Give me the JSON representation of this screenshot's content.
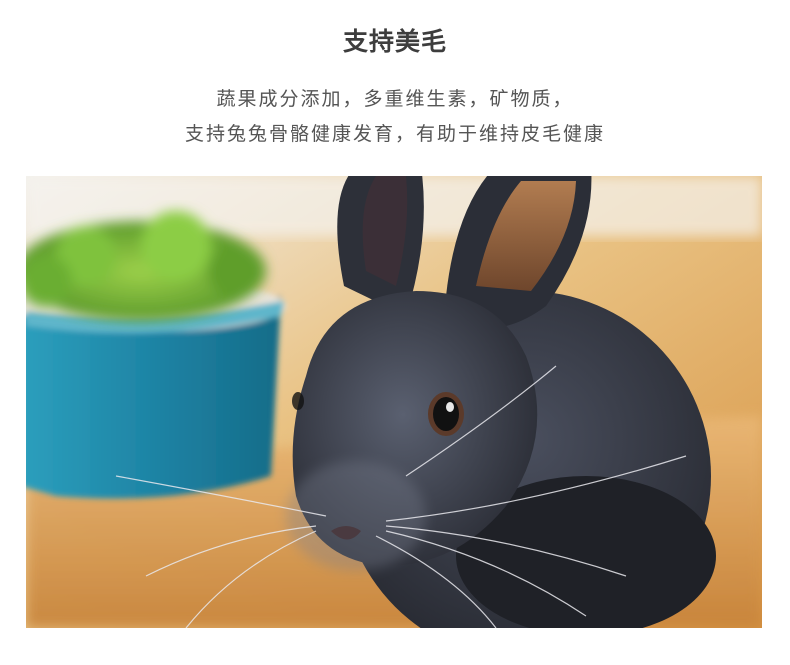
{
  "section": {
    "title": "支持美毛",
    "description_lines": [
      "蔬果成分添加，多重维生素，矿物质，",
      "支持兔兔骨骼健康发育，有助于维持皮毛健康"
    ]
  },
  "photo": {
    "subject": "dark-grey rabbit next to a blue bowl of greens"
  }
}
